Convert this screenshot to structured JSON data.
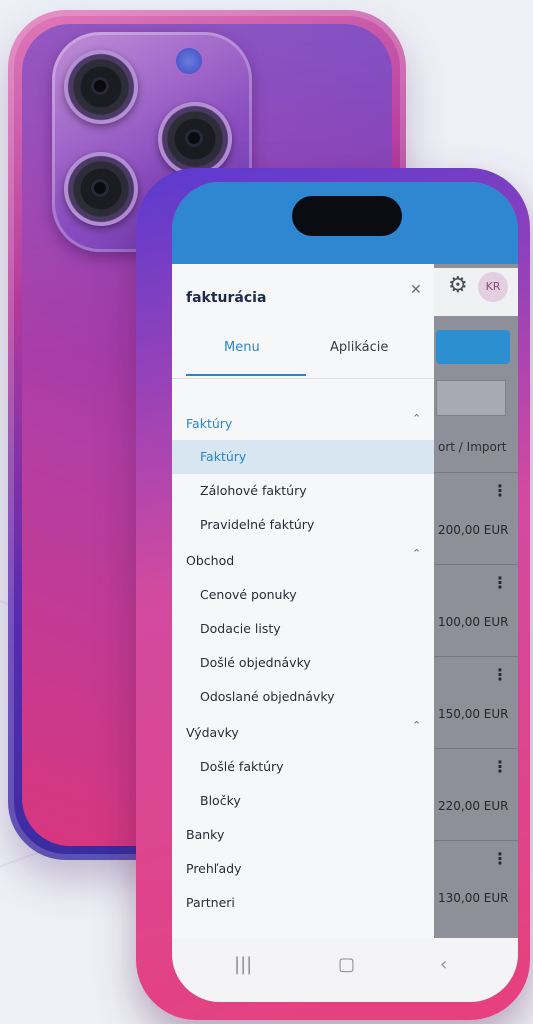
{
  "app": {
    "brand": "fakturácia",
    "avatar_initials": "KR"
  },
  "drawer": {
    "tabs": [
      {
        "label": "Menu",
        "active": true
      },
      {
        "label": "Aplikácie",
        "active": false
      }
    ],
    "sections": [
      {
        "label": "Faktúry",
        "expanded": true,
        "active_parent": true,
        "items": [
          {
            "label": "Faktúry",
            "active": true
          },
          {
            "label": "Zálohové faktúry"
          },
          {
            "label": "Pravidelné faktúry"
          }
        ]
      },
      {
        "label": "Obchod",
        "expanded": true,
        "items": [
          {
            "label": "Cenové ponuky"
          },
          {
            "label": "Dodacie listy"
          },
          {
            "label": "Došlé objednávky"
          },
          {
            "label": "Odoslané objednávky"
          }
        ]
      },
      {
        "label": "Výdavky",
        "expanded": true,
        "items": [
          {
            "label": "Došlé faktúry"
          },
          {
            "label": "Bločky"
          }
        ]
      }
    ],
    "top_items": [
      {
        "label": "Banky"
      },
      {
        "label": "Prehľady"
      },
      {
        "label": "Partneri"
      }
    ]
  },
  "background_page": {
    "export_import_label": "ort / Import",
    "amounts": [
      "200,00 EUR",
      "100,00 EUR",
      "150,00 EUR",
      "220,00 EUR",
      "130,00 EUR"
    ]
  },
  "colors": {
    "accent": "#2a85c9",
    "statusbar": "#2f86d1",
    "active_item_bg": "#d8e6f2"
  }
}
